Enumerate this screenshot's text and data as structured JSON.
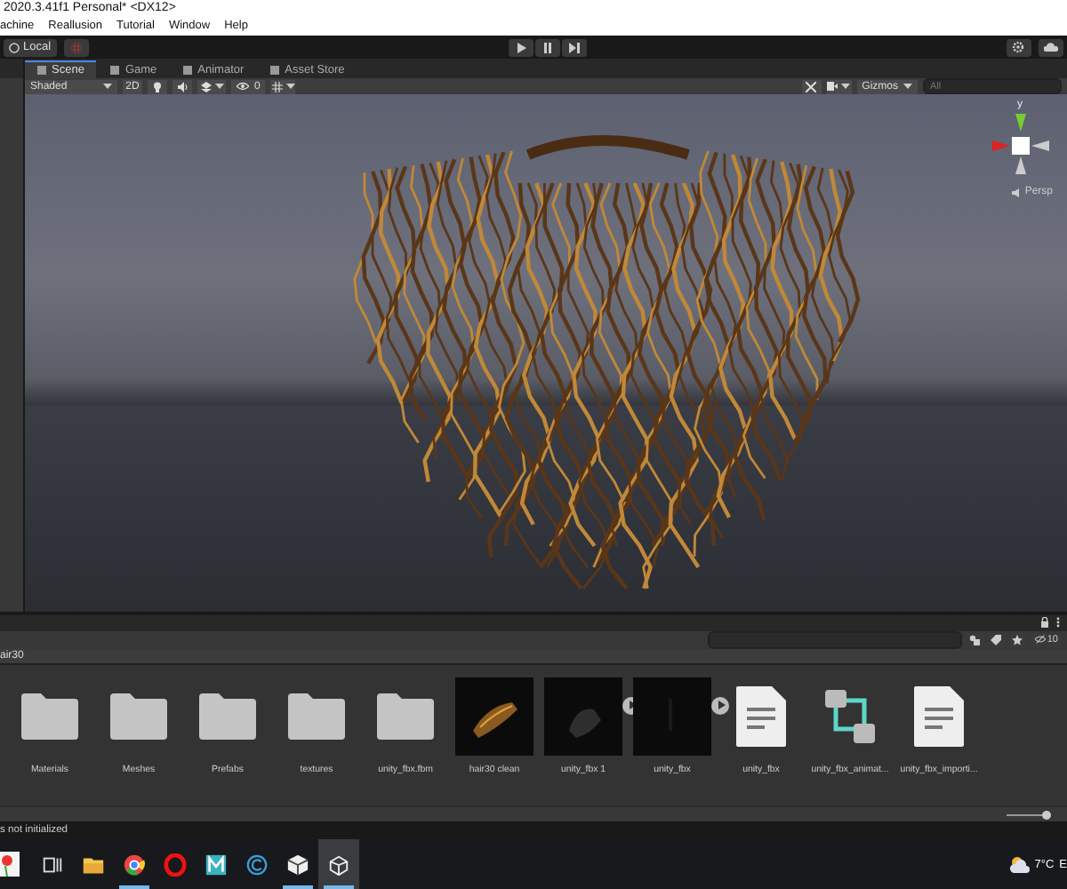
{
  "window": {
    "title": "2020.3.41f1 Personal* <DX12>"
  },
  "menu": [
    "achine",
    "Reallusion",
    "Tutorial",
    "Window",
    "Help"
  ],
  "toolbar": {
    "pivot_label": "Local"
  },
  "tabs": [
    {
      "label": "Scene",
      "selected": true
    },
    {
      "label": "Game",
      "selected": false
    },
    {
      "label": "Animator",
      "selected": false
    },
    {
      "label": "Asset Store",
      "selected": false
    }
  ],
  "scene_toolbar": {
    "shading": "Shaded",
    "mode": "2D",
    "effects_count": "0",
    "gizmos": "Gizmos",
    "search_placeholder": "All"
  },
  "scene_gizmo": {
    "axis": "y",
    "projection": "Persp"
  },
  "project": {
    "hidden_count": "10",
    "breadcrumb": "air30",
    "thumbnail_size": {
      "level": 0.92
    },
    "assets": [
      {
        "kind": "folder",
        "name": "Materials"
      },
      {
        "kind": "folder",
        "name": "Meshes"
      },
      {
        "kind": "folder",
        "name": "Prefabs"
      },
      {
        "kind": "folder",
        "name": "textures"
      },
      {
        "kind": "folder",
        "name": "unity_fbx.fbm"
      },
      {
        "kind": "model",
        "name": "hair30 clean",
        "expandable": false
      },
      {
        "kind": "model",
        "name": "unity_fbx 1",
        "expandable": true
      },
      {
        "kind": "model",
        "name": "unity_fbx",
        "expandable": true
      },
      {
        "kind": "file",
        "name": "unity_fbx"
      },
      {
        "kind": "animator",
        "name": "unity_fbx_animat..."
      },
      {
        "kind": "file",
        "name": "unity_fbx_importi..."
      }
    ]
  },
  "status": "s not initialized",
  "taskbar": {
    "apps": [
      {
        "kind": "taskview",
        "running": false,
        "selected": false
      },
      {
        "kind": "folder",
        "running": false,
        "selected": false
      },
      {
        "kind": "chrome",
        "running": true,
        "selected": false
      },
      {
        "kind": "opera",
        "running": false,
        "selected": false
      },
      {
        "kind": "m-app",
        "running": false,
        "selected": false
      },
      {
        "kind": "c-app",
        "running": false,
        "selected": false
      },
      {
        "kind": "cube",
        "running": true,
        "selected": false
      },
      {
        "kind": "unity",
        "running": true,
        "selected": true
      }
    ],
    "weather": "7°C",
    "tray_text": "E"
  }
}
